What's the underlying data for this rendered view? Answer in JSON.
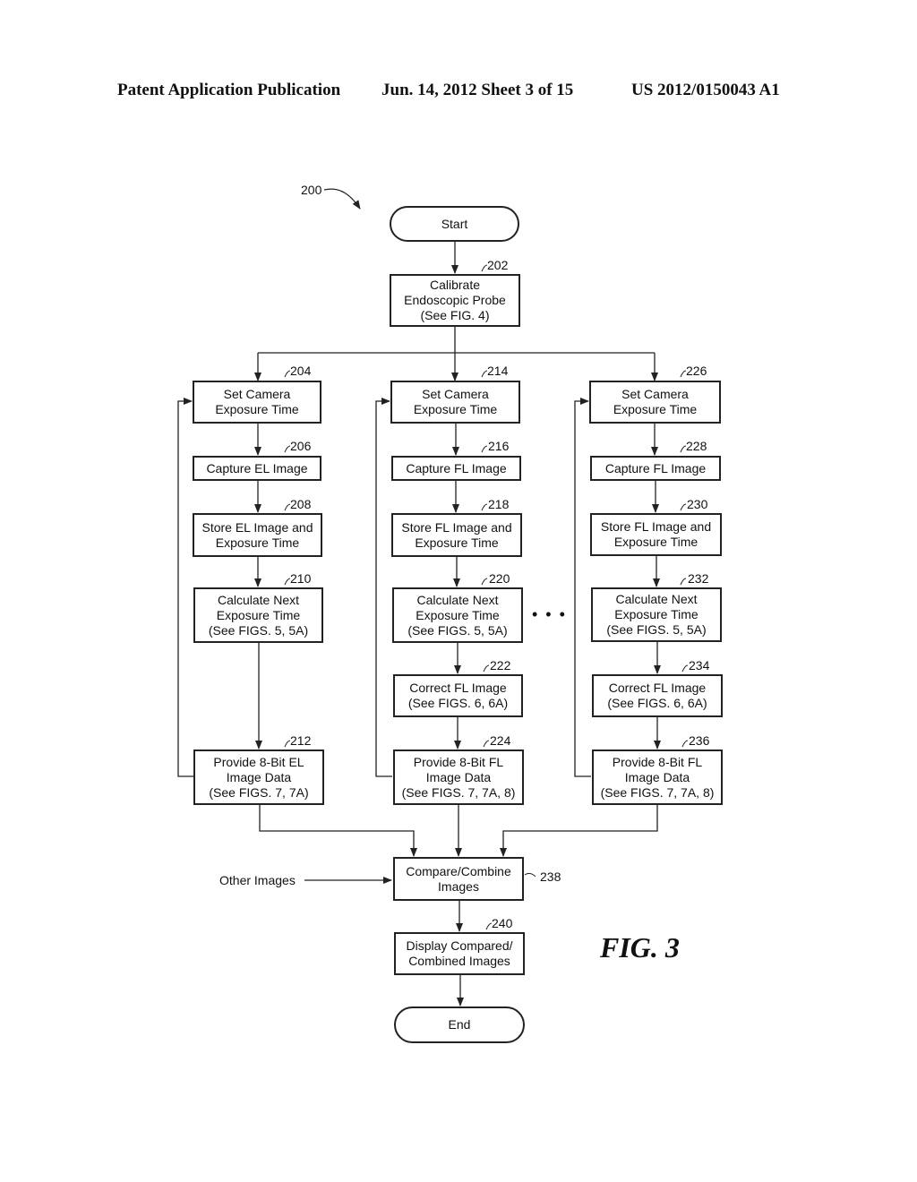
{
  "header": {
    "publication": "Patent Application Publication",
    "date_sheet": "Jun. 14, 2012  Sheet 3 of 15",
    "number": "US 2012/0150043 A1"
  },
  "figure": {
    "ref": "200",
    "label": "FIG. 3",
    "ellipsis": "• • •",
    "other_images": "Other Images"
  },
  "nodes": {
    "start": {
      "text": "Start"
    },
    "n202": {
      "ref": "202",
      "text": "Calibrate\nEndoscopic Probe\n(See FIG. 4)"
    },
    "n204": {
      "ref": "204",
      "text": "Set Camera\nExposure Time"
    },
    "n206": {
      "ref": "206",
      "text": "Capture EL Image"
    },
    "n208": {
      "ref": "208",
      "text": "Store EL Image and\nExposure Time"
    },
    "n210": {
      "ref": "210",
      "text": "Calculate Next\nExposure Time\n(See FIGS. 5, 5A)"
    },
    "n212": {
      "ref": "212",
      "text": "Provide 8-Bit EL\nImage Data\n(See FIGS. 7, 7A)"
    },
    "n214": {
      "ref": "214",
      "text": "Set Camera\nExposure Time"
    },
    "n216": {
      "ref": "216",
      "text": "Capture FL Image"
    },
    "n218": {
      "ref": "218",
      "text": "Store FL Image and\nExposure Time"
    },
    "n220": {
      "ref": "220",
      "text": "Calculate Next\nExposure Time\n(See FIGS. 5, 5A)"
    },
    "n222": {
      "ref": "222",
      "text": "Correct FL Image\n(See FIGS. 6, 6A)"
    },
    "n224": {
      "ref": "224",
      "text": "Provide 8-Bit FL\nImage Data\n(See FIGS. 7, 7A, 8)"
    },
    "n226": {
      "ref": "226",
      "text": "Set Camera\nExposure Time"
    },
    "n228": {
      "ref": "228",
      "text": "Capture FL Image"
    },
    "n230": {
      "ref": "230",
      "text": "Store FL Image and\nExposure Time"
    },
    "n232": {
      "ref": "232",
      "text": "Calculate Next\nExposure Time\n(See FIGS. 5, 5A)"
    },
    "n234": {
      "ref": "234",
      "text": "Correct FL Image\n(See FIGS. 6, 6A)"
    },
    "n236": {
      "ref": "236",
      "text": "Provide 8-Bit FL\nImage Data\n(See FIGS. 7, 7A, 8)"
    },
    "n238": {
      "ref": "238",
      "text": "Compare/Combine\nImages"
    },
    "n240": {
      "ref": "240",
      "text": "Display Compared/\nCombined Images"
    },
    "end": {
      "text": "End"
    }
  }
}
